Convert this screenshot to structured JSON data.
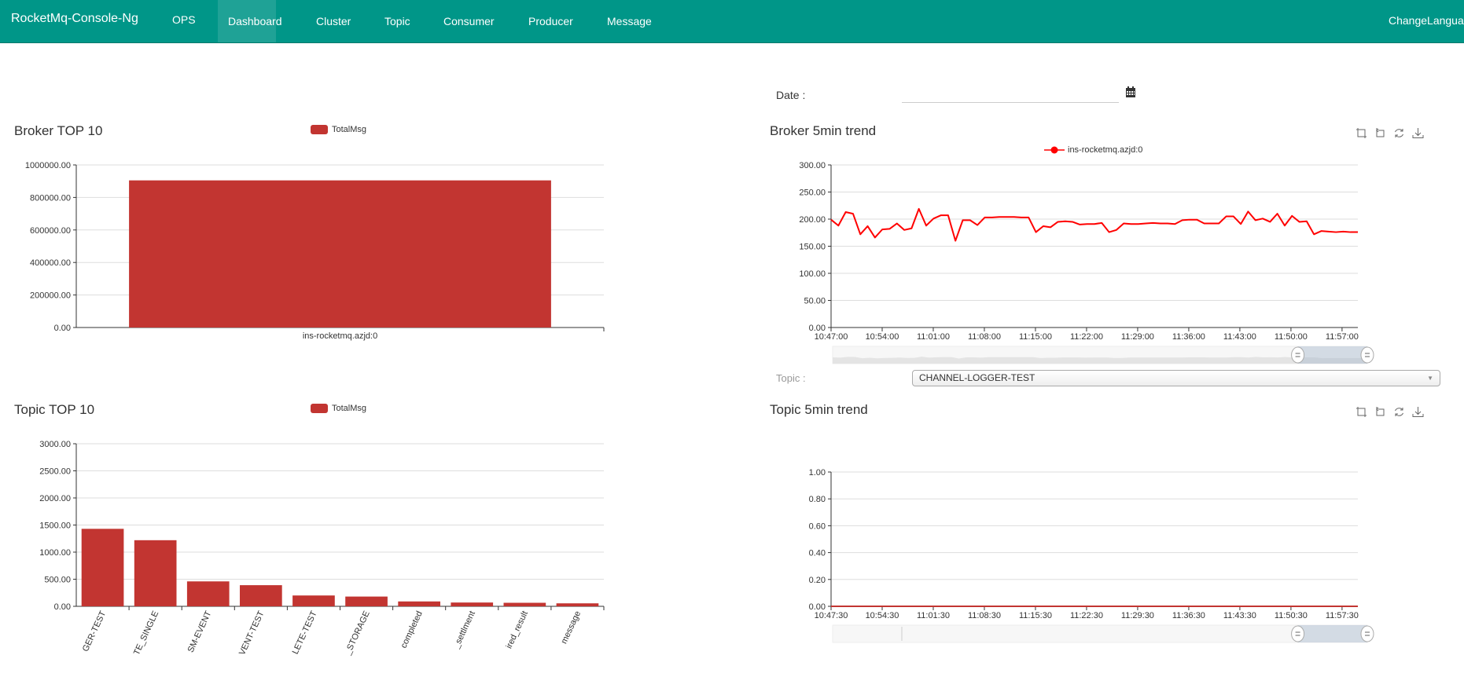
{
  "navbar": {
    "brand": "RocketMq-Console-Ng",
    "items": [
      {
        "label": "OPS",
        "active": false
      },
      {
        "label": "Dashboard",
        "active": true
      },
      {
        "label": "Cluster",
        "active": false
      },
      {
        "label": "Topic",
        "active": false
      },
      {
        "label": "Consumer",
        "active": false
      },
      {
        "label": "Producer",
        "active": false
      },
      {
        "label": "Message",
        "active": false
      }
    ],
    "change_language": "ChangeLanguage"
  },
  "date_filter": {
    "label": "Date :",
    "value": "",
    "icon": "calendar-icon"
  },
  "topic_filter": {
    "label": "Topic :",
    "selected": "CHANNEL-LOGGER-TEST"
  },
  "toolbox": {
    "icons": [
      "zoom-icon",
      "zoom-reset-icon",
      "restore-icon",
      "save-image-icon"
    ]
  },
  "colors": {
    "brand": "#009688",
    "bar": "#c23531",
    "line": "#ff0000"
  },
  "chart_data": [
    {
      "id": "broker-top10",
      "type": "bar",
      "title": "Broker TOP 10",
      "legend": [
        "TotalMsg"
      ],
      "legend_position": "top-center",
      "categories": [
        "ins-rocketmq.azjd:0"
      ],
      "series": [
        {
          "name": "TotalMsg",
          "values": [
            905000
          ]
        }
      ],
      "ylim": [
        0,
        1000000
      ],
      "yticks": [
        "0.00",
        "200000.00",
        "400000.00",
        "600000.00",
        "800000.00",
        "1000000.00"
      ],
      "grid": true
    },
    {
      "id": "broker-5min-trend",
      "type": "line",
      "title": "Broker 5min trend",
      "legend": [
        "ins-rocketmq.azjd:0"
      ],
      "legend_position": "top-center",
      "xticks": [
        "10:47:00",
        "10:54:00",
        "11:01:00",
        "11:08:00",
        "11:15:00",
        "11:22:00",
        "11:29:00",
        "11:36:00",
        "11:43:00",
        "11:50:00",
        "11:57:00"
      ],
      "ylim": [
        0,
        300
      ],
      "yticks": [
        "0.00",
        "50.00",
        "100.00",
        "150.00",
        "200.00",
        "250.00",
        "300.00"
      ],
      "series": [
        {
          "name": "ins-rocketmq.azjd:0",
          "values": [
            199,
            188,
            213,
            210,
            172,
            187,
            166,
            181,
            182,
            192,
            180,
            183,
            219,
            188,
            201,
            207,
            207,
            160,
            198,
            198,
            189,
            203,
            203,
            204,
            204,
            204,
            203,
            203,
            176,
            187,
            185,
            195,
            196,
            195,
            190,
            191,
            191,
            193,
            176,
            180,
            192,
            191,
            191,
            192,
            193,
            192,
            192,
            191,
            198,
            199,
            199,
            192,
            192,
            192,
            205,
            205,
            191,
            214,
            198,
            201,
            195,
            210,
            188,
            206,
            195,
            196,
            172,
            178,
            177,
            176,
            177,
            176,
            176
          ]
        }
      ],
      "data_zoom": {
        "start": 0.87,
        "end": 1.0
      },
      "grid": true
    },
    {
      "id": "topic-top10",
      "type": "bar",
      "title": "Topic TOP 10",
      "legend": [
        "TotalMsg"
      ],
      "legend_position": "top-center",
      "categories": [
        "GER-TEST",
        "TE_SINGLE",
        "SM-EVENT",
        "VENT-TEST",
        "LETE-TEST",
        "_STORAGE",
        "completed",
        "_settlment",
        "ired_result",
        "message"
      ],
      "series": [
        {
          "name": "TotalMsg",
          "values": [
            1430,
            1220,
            460,
            390,
            200,
            180,
            90,
            70,
            65,
            55
          ]
        }
      ],
      "ylim": [
        0,
        3000
      ],
      "yticks": [
        "0.00",
        "500.00",
        "1000.00",
        "1500.00",
        "2000.00",
        "2500.00",
        "3000.00"
      ],
      "grid": true
    },
    {
      "id": "topic-5min-trend",
      "type": "line",
      "title": "Topic 5min trend",
      "legend": [],
      "xticks": [
        "10:47:30",
        "10:54:30",
        "11:01:30",
        "11:08:30",
        "11:15:30",
        "11:22:30",
        "11:29:30",
        "11:36:30",
        "11:43:30",
        "11:50:30",
        "11:57:30"
      ],
      "ylim": [
        0,
        1
      ],
      "yticks": [
        "0.00",
        "0.20",
        "0.40",
        "0.60",
        "0.80",
        "1.00"
      ],
      "series": [
        {
          "name": "CHANNEL-LOGGER-TEST",
          "values": [
            0,
            0,
            0,
            0,
            0,
            0,
            0,
            0,
            0,
            0,
            0
          ]
        }
      ],
      "data_zoom": {
        "start": 0.87,
        "end": 1.0
      },
      "grid": true
    }
  ]
}
